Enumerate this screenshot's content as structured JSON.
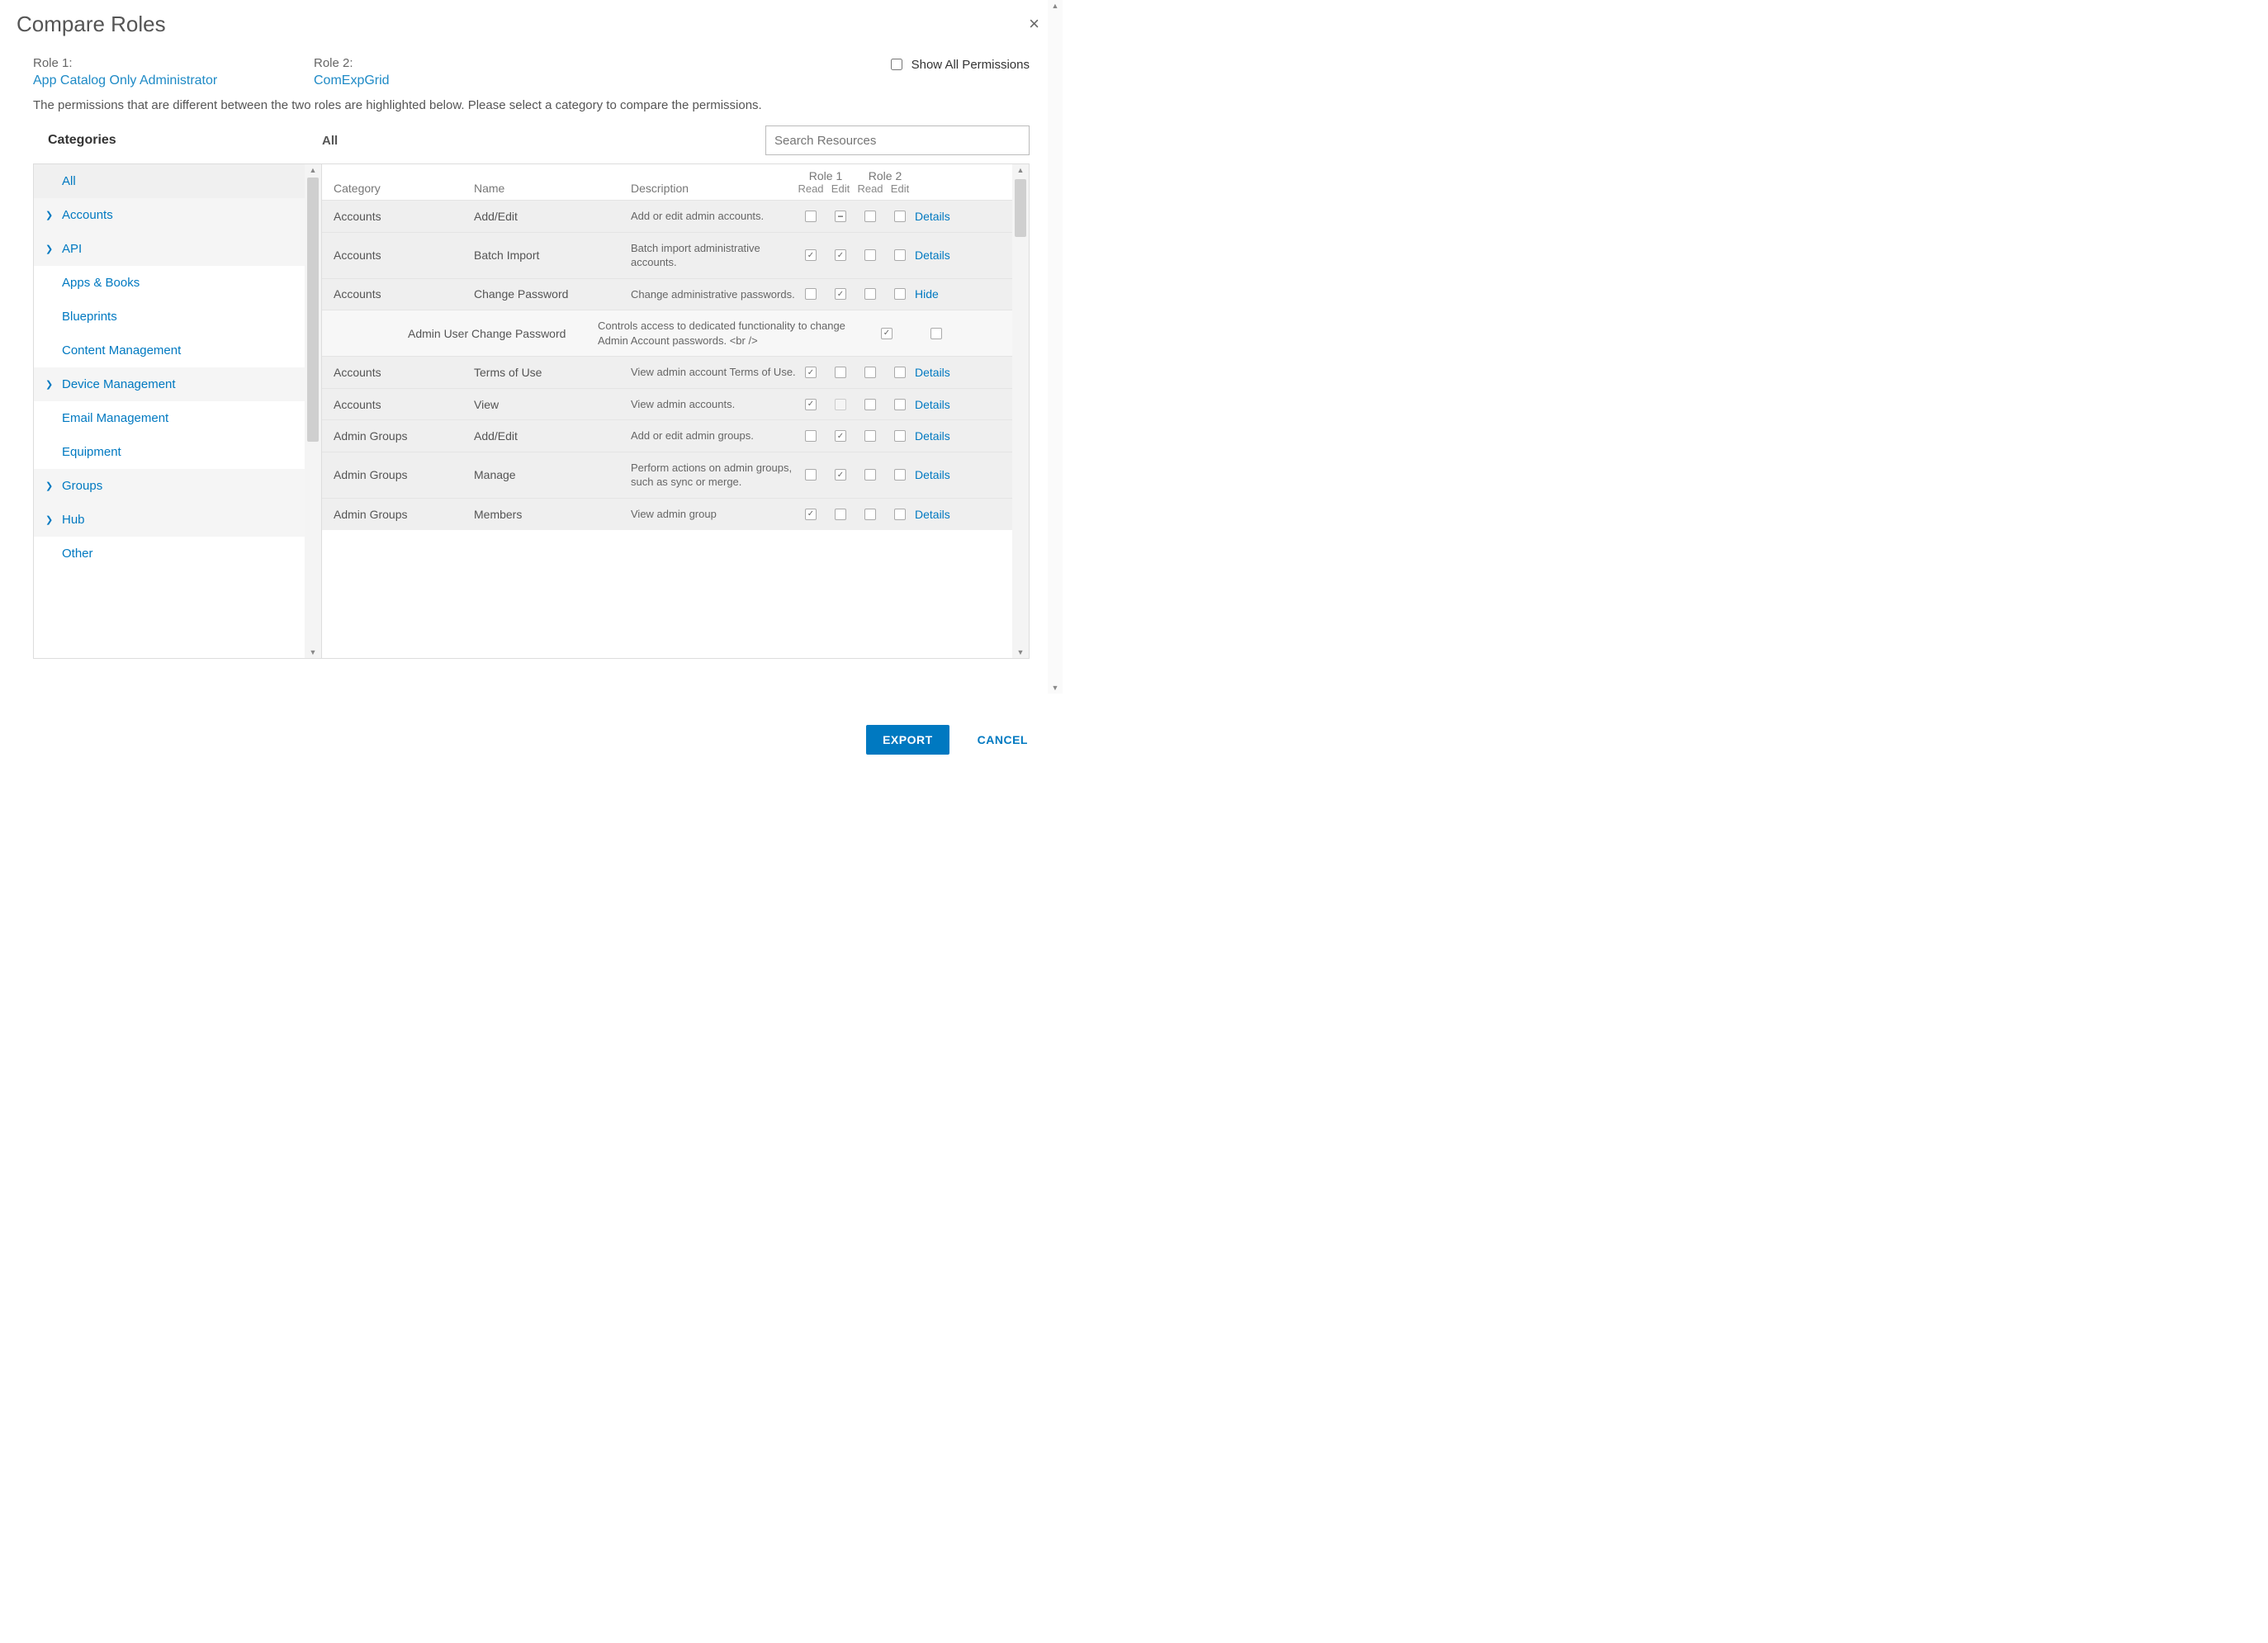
{
  "dialog": {
    "title": "Compare Roles",
    "close_icon": "×"
  },
  "roles": {
    "role1_label": "Role 1:",
    "role1_value": "App Catalog Only Administrator",
    "role2_label": "Role 2:",
    "role2_value": "ComExpGrid",
    "show_all_label": "Show All Permissions",
    "show_all_checked": false
  },
  "instruction": "The permissions that are different between the two roles are highlighted below. Please select a category to compare the permissions.",
  "headers": {
    "categories": "Categories",
    "all": "All",
    "search_placeholder": "Search Resources"
  },
  "sidebar": {
    "items": [
      {
        "label": "All",
        "expandable": false,
        "selected": true
      },
      {
        "label": "Accounts",
        "expandable": true,
        "selected": false
      },
      {
        "label": "API",
        "expandable": true,
        "selected": false
      },
      {
        "label": "Apps & Books",
        "expandable": false,
        "selected": false
      },
      {
        "label": "Blueprints",
        "expandable": false,
        "selected": false
      },
      {
        "label": "Content Management",
        "expandable": false,
        "selected": false
      },
      {
        "label": "Device Management",
        "expandable": true,
        "selected": false
      },
      {
        "label": "Email Management",
        "expandable": false,
        "selected": false
      },
      {
        "label": "Equipment",
        "expandable": false,
        "selected": false
      },
      {
        "label": "Groups",
        "expandable": true,
        "selected": false
      },
      {
        "label": "Hub",
        "expandable": true,
        "selected": false
      },
      {
        "label": "Other",
        "expandable": false,
        "selected": false
      }
    ]
  },
  "table": {
    "columns": {
      "category": "Category",
      "name": "Name",
      "description": "Description",
      "role1": "Role 1",
      "role2": "Role 2",
      "read": "Read",
      "edit": "Edit"
    },
    "rows": [
      {
        "category": "Accounts",
        "name": "Add/Edit",
        "description": "Add or edit admin accounts.",
        "r1_read": "",
        "r1_edit": "indet",
        "r2_read": "",
        "r2_edit": "",
        "action": "Details"
      },
      {
        "category": "Accounts",
        "name": "Batch Import",
        "description": "Batch import administrative accounts.",
        "r1_read": "checked",
        "r1_edit": "checked",
        "r2_read": "",
        "r2_edit": "",
        "action": "Details"
      },
      {
        "category": "Accounts",
        "name": "Change Password",
        "description": "Change administrative passwords.",
        "r1_read": "",
        "r1_edit": "checked",
        "r2_read": "",
        "r2_edit": "",
        "action": "Hide"
      },
      {
        "detail": true,
        "name": "Admin User Change Password",
        "description": "Controls access to dedicated functionality to change Admin Account passwords. <br />",
        "c1": "checked",
        "c2": ""
      },
      {
        "category": "Accounts",
        "name": "Terms of Use",
        "description": "View admin account Terms of Use.",
        "r1_read": "checked",
        "r1_edit": "",
        "r2_read": "",
        "r2_edit": "",
        "action": "Details"
      },
      {
        "category": "Accounts",
        "name": "View",
        "description": "View admin accounts.",
        "r1_read": "checked",
        "r1_edit": "dis",
        "r2_read": "",
        "r2_edit": "",
        "action": "Details"
      },
      {
        "category": "Admin Groups",
        "name": "Add/Edit",
        "description": "Add or edit admin groups.",
        "r1_read": "",
        "r1_edit": "checked",
        "r2_read": "",
        "r2_edit": "",
        "action": "Details"
      },
      {
        "category": "Admin Groups",
        "name": "Manage",
        "description": "Perform actions on admin groups, such as sync or merge.",
        "r1_read": "",
        "r1_edit": "checked",
        "r2_read": "",
        "r2_edit": "",
        "action": "Details"
      },
      {
        "category": "Admin Groups",
        "name": "Members",
        "description": "View admin group",
        "r1_read": "checked",
        "r1_edit": "",
        "r2_read": "",
        "r2_edit": "",
        "action": "Details"
      }
    ]
  },
  "footer": {
    "export": "EXPORT",
    "cancel": "CANCEL"
  }
}
